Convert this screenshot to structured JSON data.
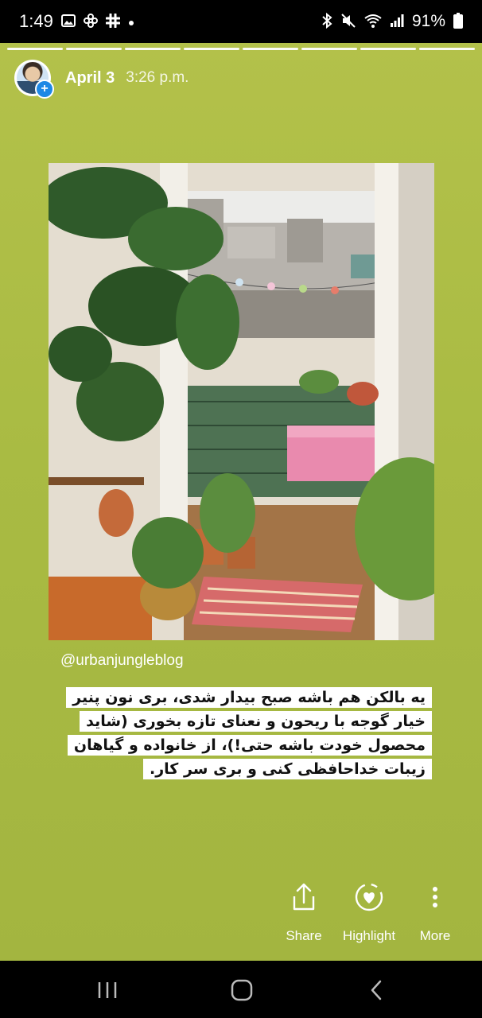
{
  "status_bar": {
    "time": "1:49",
    "battery": "91%",
    "left_icons": [
      "image-icon",
      "pinwheel-icon",
      "slack-icon",
      "dot-icon"
    ],
    "right_icons": [
      "bluetooth-icon",
      "mute-icon",
      "wifi-icon",
      "signal-icon",
      "battery-icon"
    ]
  },
  "story": {
    "progress_segments": 8,
    "date": "April 3",
    "time": "3:26 p.m.",
    "background_color": "#a3b540",
    "handle": "@urbanjungleblog",
    "caption": "یه بالکن هم باشه صبح بیدار شدی، بری نون پنیر خیار گوجه با ریحون و نعنای تازه بخوری (شاید محصول خودت باشه حتی!)، از خانواده و گیاهان زیبات خداحافظی کنی و بری سر کار."
  },
  "actions": [
    {
      "label": "Share",
      "icon": "share-icon"
    },
    {
      "label": "Highlight",
      "icon": "highlight-heart-icon"
    },
    {
      "label": "More",
      "icon": "more-vertical-icon"
    }
  ],
  "nav_bar": {
    "icons": [
      "recent-apps-icon",
      "home-icon",
      "back-icon"
    ]
  }
}
